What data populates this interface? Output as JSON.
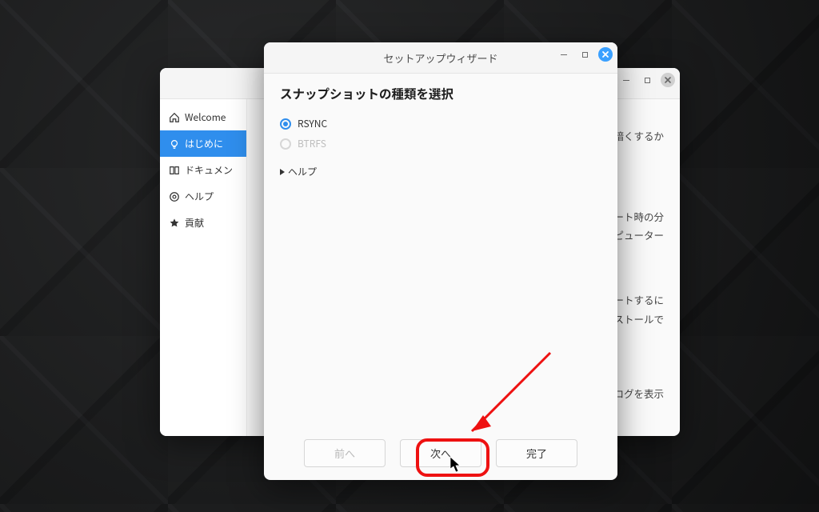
{
  "help_window": {
    "titlebar": "",
    "sidebar": {
      "items": [
        {
          "label": "Welcome",
          "icon": "home-icon"
        },
        {
          "label": "はじめに",
          "icon": "bulb-icon",
          "active": true
        },
        {
          "label": "ドキュメン",
          "icon": "book-icon"
        },
        {
          "label": "ヘルプ",
          "icon": "ring-icon"
        },
        {
          "label": "貢献",
          "icon": "star-icon"
        }
      ]
    },
    "content_fragments": [
      "暗くするか",
      "ブート時の分\nンピューター",
      "ートするに\nンストールで",
      "イアログを表示"
    ]
  },
  "wizard_window": {
    "title": "セットアップウィザード",
    "heading": "スナップショットの種類を選択",
    "options": {
      "rsync": {
        "label": "RSYNC",
        "selected": true,
        "enabled": true
      },
      "btrfs": {
        "label": "BTRFS",
        "selected": false,
        "enabled": false
      }
    },
    "expander_label": "ヘルプ",
    "buttons": {
      "prev": {
        "label": "前へ",
        "enabled": false
      },
      "next": {
        "label": "次へ",
        "enabled": true
      },
      "finish": {
        "label": "完了",
        "enabled": true
      }
    }
  },
  "annotation": {
    "target": "next-button"
  }
}
